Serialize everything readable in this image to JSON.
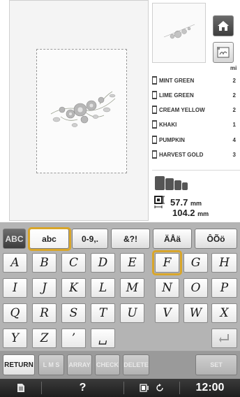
{
  "threads": {
    "count_label": "mi",
    "items": [
      {
        "name": "MINT GREEN",
        "count": "2"
      },
      {
        "name": "LIME GREEN",
        "count": "2"
      },
      {
        "name": "CREAM YELLOW",
        "count": "2"
      },
      {
        "name": "KHAKI",
        "count": "1"
      },
      {
        "name": "PUMPKIN",
        "count": "4"
      },
      {
        "name": "HARVEST GOLD",
        "count": "3"
      }
    ]
  },
  "size": {
    "height": "57.7",
    "width": "104.2",
    "unit": "mm"
  },
  "keyboard": {
    "tabs": [
      "ABC",
      "abc",
      "0-9,.",
      "&?!",
      "ÄÅä",
      "ÔÕö"
    ],
    "active_tab": "ABC",
    "selected_tab": "abc",
    "rows": [
      [
        "A",
        "B",
        "C",
        "D",
        "E",
        "F",
        "G",
        "H"
      ],
      [
        "I",
        "J",
        "K",
        "L",
        "M",
        "N",
        "O",
        "P"
      ],
      [
        "Q",
        "R",
        "S",
        "T",
        "U",
        "V",
        "W",
        "X"
      ],
      [
        "Y",
        "Z",
        "’",
        "␣"
      ]
    ],
    "selected_key": "F"
  },
  "actions": {
    "return": "RETURN",
    "lms": "L M S",
    "array": "ARRAY",
    "check": "CHECK",
    "delete": "DELETE",
    "set": "SET"
  },
  "status": {
    "help": "?",
    "time": "12:00"
  },
  "colors": {
    "highlight": "#d9a62a",
    "keyboard_bg": "#b4b4b4",
    "status_bg": "#2a2a2a"
  },
  "icons": [
    "home-icon",
    "edit-pattern-icon",
    "thread-spool-icon",
    "stitch-count-icon",
    "size-icon",
    "enter-icon",
    "document-icon",
    "bobbin-icon",
    "rotate-icon"
  ]
}
